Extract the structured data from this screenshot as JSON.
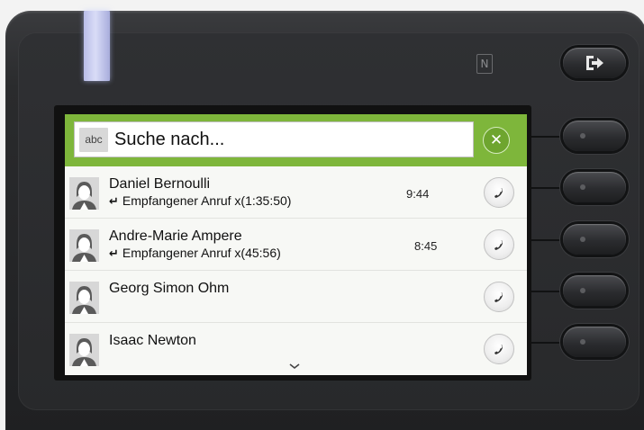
{
  "search": {
    "badge": "abc",
    "placeholder": "Suche nach...",
    "clear_icon": "close-icon"
  },
  "contacts": [
    {
      "name": "Daniel Bernoulli",
      "detail_icon": "received-call-icon",
      "detail": "Empfangener Anruf x(1:35:50)",
      "time": "9:44",
      "action_icon": "phone-handset-icon"
    },
    {
      "name": "Andre-Marie Ampere",
      "detail_icon": "received-call-icon",
      "detail": "Empfangener Anruf x(45:56)",
      "time": "8:45",
      "action_icon": "phone-handset-icon"
    },
    {
      "name": "Georg Simon Ohm",
      "action_icon": "phone-handset-icon"
    },
    {
      "name": "Isaac Newton",
      "action_icon": "phone-handset-icon"
    }
  ],
  "hardware": {
    "logout_icon": "logout-icon",
    "nfc_icon": "nfc-icon"
  },
  "colors": {
    "search_bar": "#7eb63b",
    "clear_button": "#6ea52f",
    "led": "#c9cdf3"
  }
}
